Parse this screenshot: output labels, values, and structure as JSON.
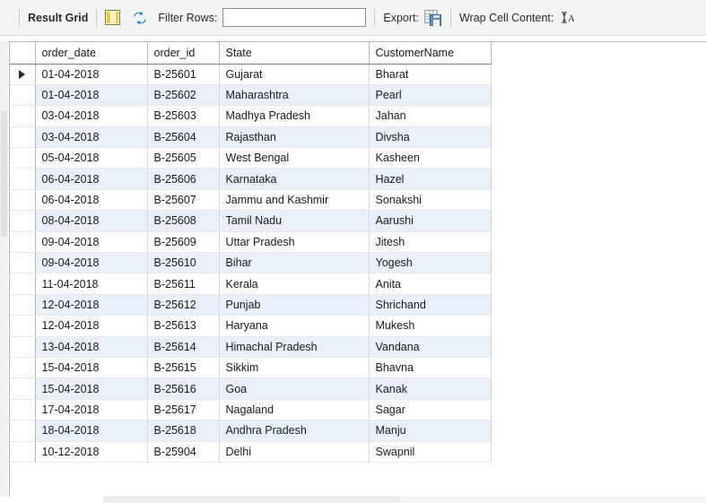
{
  "toolbar": {
    "result_grid_label": "Result Grid",
    "result_grid_icon": "grid-columns-icon",
    "refresh_icon": "refresh-icon",
    "filter_label": "Filter Rows:",
    "filter_value": "",
    "filter_placeholder": "",
    "export_label": "Export:",
    "export_icon": "export-to-file-icon",
    "wrap_label": "Wrap Cell Content:",
    "wrap_icon": "wrap-cell-content-icon"
  },
  "grid": {
    "columns": [
      "order_date",
      "order_id",
      "State",
      "CustomerName"
    ],
    "selected_row_index": 0,
    "row_marker": "▶",
    "rows": [
      [
        "01-04-2018",
        "B-25601",
        "Gujarat",
        "Bharat"
      ],
      [
        "01-04-2018",
        "B-25602",
        "Maharashtra",
        "Pearl"
      ],
      [
        "03-04-2018",
        "B-25603",
        "Madhya Pradesh",
        "Jahan"
      ],
      [
        "03-04-2018",
        "B-25604",
        "Rajasthan",
        "Divsha"
      ],
      [
        "05-04-2018",
        "B-25605",
        "West Bengal",
        "Kasheen"
      ],
      [
        "06-04-2018",
        "B-25606",
        "Karnataka",
        "Hazel"
      ],
      [
        "06-04-2018",
        "B-25607",
        "Jammu and Kashmir",
        "Sonakshi"
      ],
      [
        "08-04-2018",
        "B-25608",
        "Tamil Nadu",
        "Aarushi"
      ],
      [
        "09-04-2018",
        "B-25609",
        "Uttar Pradesh",
        "Jitesh"
      ],
      [
        "09-04-2018",
        "B-25610",
        "Bihar",
        "Yogesh"
      ],
      [
        "11-04-2018",
        "B-25611",
        "Kerala",
        "Anita"
      ],
      [
        "12-04-2018",
        "B-25612",
        "Punjab",
        "Shrichand"
      ],
      [
        "12-04-2018",
        "B-25613",
        "Haryana",
        "Mukesh"
      ],
      [
        "13-04-2018",
        "B-25614",
        "Himachal Pradesh",
        "Vandana"
      ],
      [
        "15-04-2018",
        "B-25615",
        "Sikkim",
        "Bhavna"
      ],
      [
        "15-04-2018",
        "B-25616",
        "Goa",
        "Kanak"
      ],
      [
        "17-04-2018",
        "B-25617",
        "Nagaland",
        "Sagar"
      ],
      [
        "18-04-2018",
        "B-25618",
        "Andhra Pradesh",
        "Manju"
      ],
      [
        "10-12-2018",
        "B-25904",
        "Delhi",
        "Swapnil"
      ]
    ]
  },
  "colors": {
    "toolbar_bg": "#f3f3f3",
    "alt_row_bg": "#e9f0fb",
    "row_bg": "#ffffff",
    "grid_line": "#d7d7d7",
    "accent_blue": "#1a6fb5",
    "icon_yellow": "#f5c93c"
  }
}
